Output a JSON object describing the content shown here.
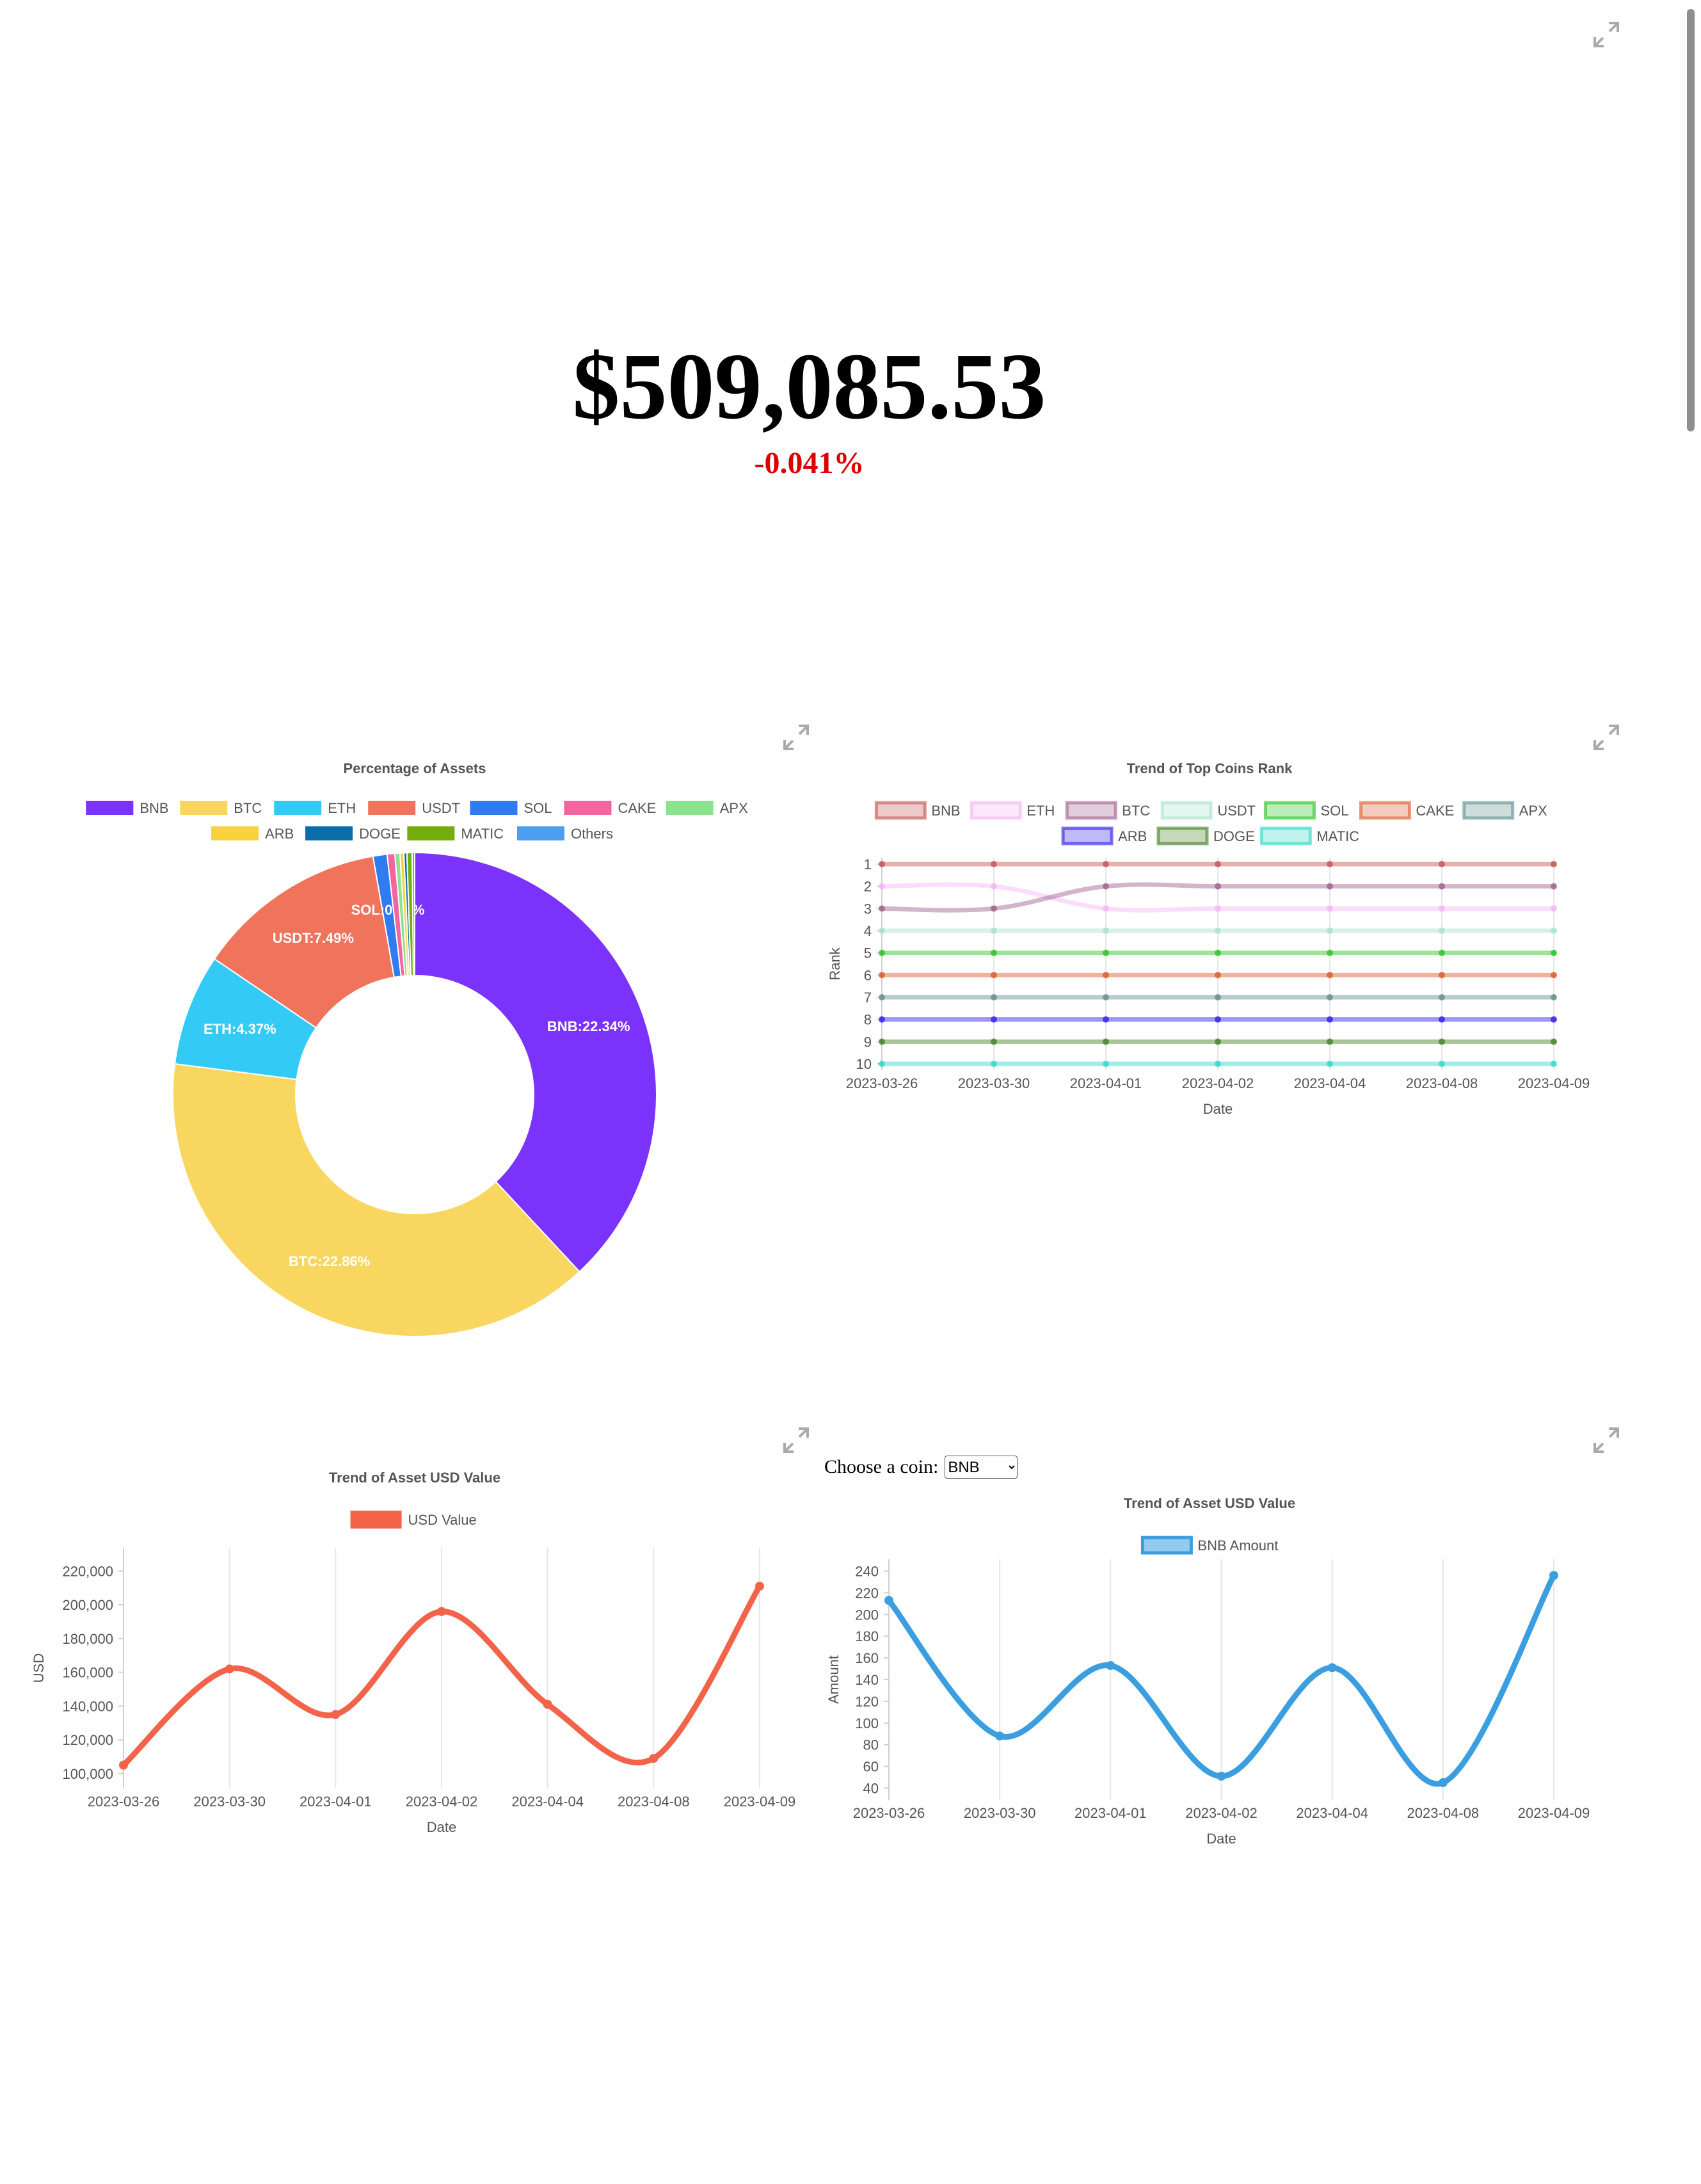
{
  "summary": {
    "total_value": "$509,085.53",
    "change": "-0.041%",
    "change_color": "#dd0000"
  },
  "coin_picker": {
    "label": "Choose a coin:",
    "selected": "BNB",
    "options": [
      "BNB"
    ]
  },
  "icons": {
    "expand": "expand-arrows-icon"
  },
  "chart_data": [
    {
      "id": "assets-donut",
      "type": "pie",
      "title": "Percentage of Assets",
      "legend_position": "top",
      "slices": [
        {
          "name": "BNB",
          "value": 22.34,
          "label": "BNB:22.34%",
          "color": "#7b32fa"
        },
        {
          "name": "BTC",
          "value": 22.86,
          "label": "BTC:22.86%",
          "color": "#f9d65f"
        },
        {
          "name": "ETH",
          "value": 4.37,
          "label": "ETH:4.37%",
          "color": "#33cbf6"
        },
        {
          "name": "USDT",
          "value": 7.49,
          "label": "USDT:7.49%",
          "color": "#f0745c"
        },
        {
          "name": "SOL",
          "value": 0.55,
          "label": "SOL:0.55%",
          "color": "#2f7cf1"
        },
        {
          "name": "CAKE",
          "value": 0.3,
          "label": "",
          "color": "#f2659f"
        },
        {
          "name": "APX",
          "value": 0.2,
          "label": "",
          "color": "#8be38f"
        },
        {
          "name": "ARB",
          "value": 0.15,
          "label": "",
          "color": "#f8d23c"
        },
        {
          "name": "DOGE",
          "value": 0.12,
          "label": "",
          "color": "#0a6fa8"
        },
        {
          "name": "MATIC",
          "value": 0.2,
          "label": "",
          "color": "#74ac0a"
        },
        {
          "name": "Others",
          "value": 0.1,
          "label": "",
          "color": "#4c9ef1"
        }
      ]
    },
    {
      "id": "rank-trend",
      "type": "line",
      "title": "Trend of Top Coins Rank",
      "xlabel": "Date",
      "ylabel": "Rank",
      "ylim": [
        1,
        10
      ],
      "y_reversed": true,
      "legend_position": "top",
      "categories": [
        "2023-03-26",
        "2023-03-30",
        "2023-04-01",
        "2023-04-02",
        "2023-04-04",
        "2023-04-08",
        "2023-04-09"
      ],
      "y_ticks": [
        1,
        2,
        3,
        4,
        5,
        6,
        7,
        8,
        9,
        10
      ],
      "series": [
        {
          "name": "BNB",
          "color": "#c0504d",
          "values": [
            1,
            1,
            1,
            1,
            1,
            1,
            1
          ]
        },
        {
          "name": "ETH",
          "color": "#f3b3f3",
          "values": [
            2,
            2,
            3,
            3,
            3,
            3,
            3
          ]
        },
        {
          "name": "BTC",
          "color": "#9c5b88",
          "values": [
            3,
            3,
            2,
            2,
            2,
            2,
            2
          ]
        },
        {
          "name": "USDT",
          "color": "#a6e2cc",
          "values": [
            4,
            4,
            4,
            4,
            4,
            4,
            4
          ]
        },
        {
          "name": "SOL",
          "color": "#1fc41f",
          "values": [
            5,
            5,
            5,
            5,
            5,
            5,
            5
          ]
        },
        {
          "name": "CAKE",
          "color": "#d8572a",
          "values": [
            6,
            6,
            6,
            6,
            6,
            6,
            6
          ]
        },
        {
          "name": "APX",
          "color": "#5d8b8b",
          "values": [
            7,
            7,
            7,
            7,
            7,
            7,
            7
          ]
        },
        {
          "name": "ARB",
          "color": "#2b17e6",
          "values": [
            8,
            8,
            8,
            8,
            8,
            8,
            8
          ]
        },
        {
          "name": "DOGE",
          "color": "#3e7d1e",
          "values": [
            9,
            9,
            9,
            9,
            9,
            9,
            9
          ]
        },
        {
          "name": "MATIC",
          "color": "#2fd6c5",
          "values": [
            10,
            10,
            10,
            10,
            10,
            10,
            10
          ]
        }
      ]
    },
    {
      "id": "usd-trend",
      "type": "line",
      "title": "Trend of Asset USD Value",
      "xlabel": "Date",
      "ylabel": "USD",
      "ylim": [
        95000,
        230000
      ],
      "legend_position": "top",
      "categories": [
        "2023-03-26",
        "2023-03-30",
        "2023-04-01",
        "2023-04-02",
        "2023-04-04",
        "2023-04-08",
        "2023-04-09"
      ],
      "y_ticks": [
        100000,
        120000,
        140000,
        160000,
        180000,
        200000,
        220000
      ],
      "y_tick_labels": [
        "100,000",
        "120,000",
        "140,000",
        "160,000",
        "180,000",
        "200,000",
        "220,000"
      ],
      "series": [
        {
          "name": "USD Value",
          "color": "#f2634a",
          "values": [
            105000,
            162000,
            135000,
            196000,
            141000,
            109000,
            211000
          ]
        }
      ]
    },
    {
      "id": "coin-trend",
      "type": "line",
      "title": "Trend of Asset USD Value",
      "xlabel": "Date",
      "ylabel": "Amount",
      "ylim": [
        35,
        245
      ],
      "legend_position": "top",
      "categories": [
        "2023-03-26",
        "2023-03-30",
        "2023-04-01",
        "2023-04-02",
        "2023-04-04",
        "2023-04-08",
        "2023-04-09"
      ],
      "y_ticks": [
        40,
        60,
        80,
        100,
        120,
        140,
        160,
        180,
        200,
        220,
        240
      ],
      "y_tick_labels": [
        "40",
        "60",
        "80",
        "100",
        "120",
        "140",
        "160",
        "180",
        "200",
        "220",
        "240"
      ],
      "series": [
        {
          "name": "BNB Amount",
          "color": "#3a9ee0",
          "values": [
            213,
            88,
            153,
            51,
            151,
            45,
            236
          ]
        }
      ]
    }
  ]
}
